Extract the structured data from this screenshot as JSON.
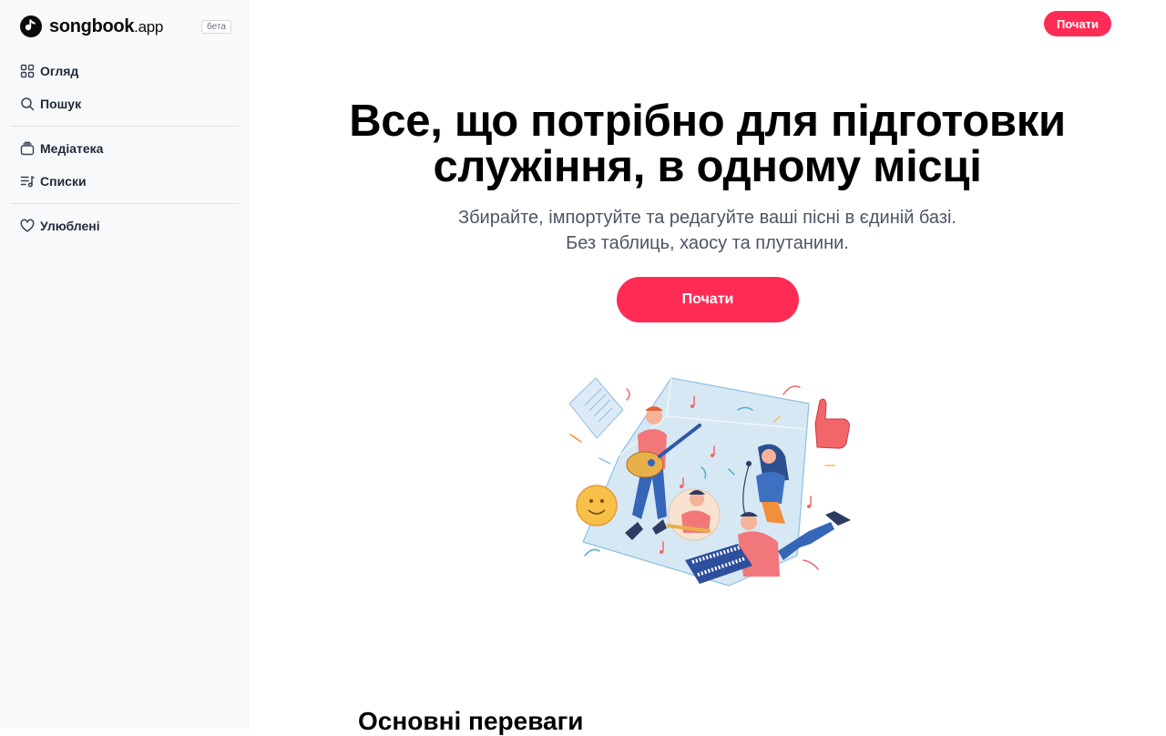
{
  "brand": {
    "name": "songbook",
    "tld": ".app",
    "badge": "бета",
    "accent": "#fe2c55"
  },
  "sidebar": {
    "groups": [
      [
        {
          "label": "Огляд",
          "icon": "grid-icon"
        },
        {
          "label": "Пошук",
          "icon": "search-icon"
        }
      ],
      [
        {
          "label": "Медіатека",
          "icon": "library-icon"
        },
        {
          "label": "Списки",
          "icon": "playlist-icon"
        }
      ],
      [
        {
          "label": "Улюблені",
          "icon": "heart-icon"
        }
      ]
    ]
  },
  "header": {
    "start_label": "Почати"
  },
  "hero": {
    "title": "Все, що потрібно для підготовки служіння, в одному місці",
    "subtitle_line1": "Збирайте, імпортуйте та редагуйте ваші пісні в єдиній базі.",
    "subtitle_line2": "Без таблиць, хаосу та плутанини.",
    "cta_label": "Почати"
  },
  "features": {
    "title": "Основні переваги"
  }
}
